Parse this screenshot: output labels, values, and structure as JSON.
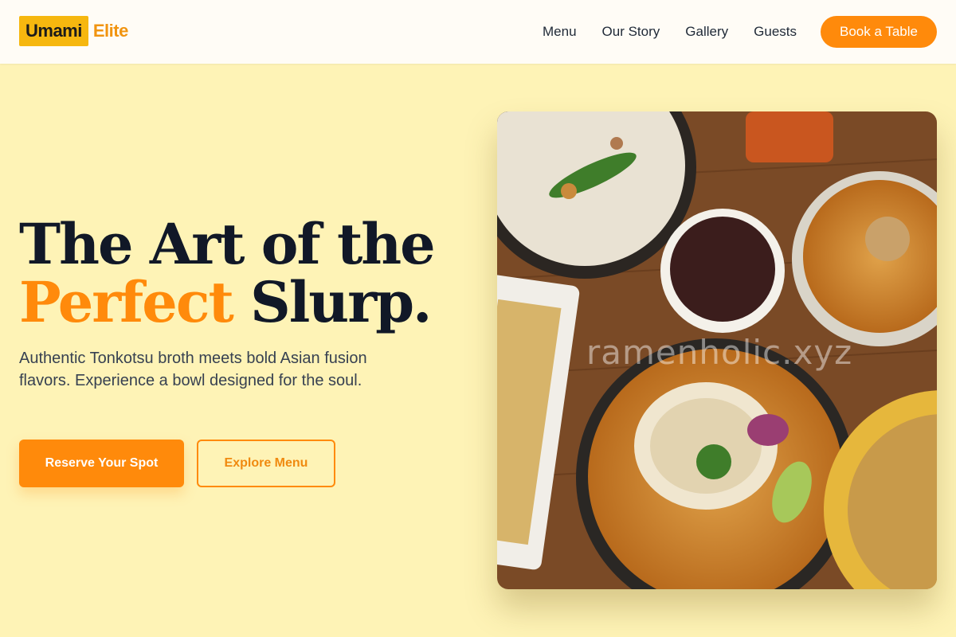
{
  "brand": {
    "name_box": "Umami",
    "name_rest": "Elite",
    "colors": {
      "box": "#f6b70f",
      "accent": "#ff8a0b"
    }
  },
  "nav": {
    "links": [
      "Menu",
      "Our Story",
      "Gallery",
      "Guests"
    ],
    "cta": "Book a Table"
  },
  "hero": {
    "title_line1": "The Art of the",
    "title_accent": "Perfect",
    "title_line2_rest": "Slurp.",
    "subtitle": "Authentic Tonkotsu broth meets bold Asian fusion flavors. Experience a bowl designed for the soul.",
    "primary_button": "Reserve Your Spot",
    "secondary_button": "Explore Menu"
  },
  "image": {
    "watermark": "ramenholic.xyz"
  }
}
